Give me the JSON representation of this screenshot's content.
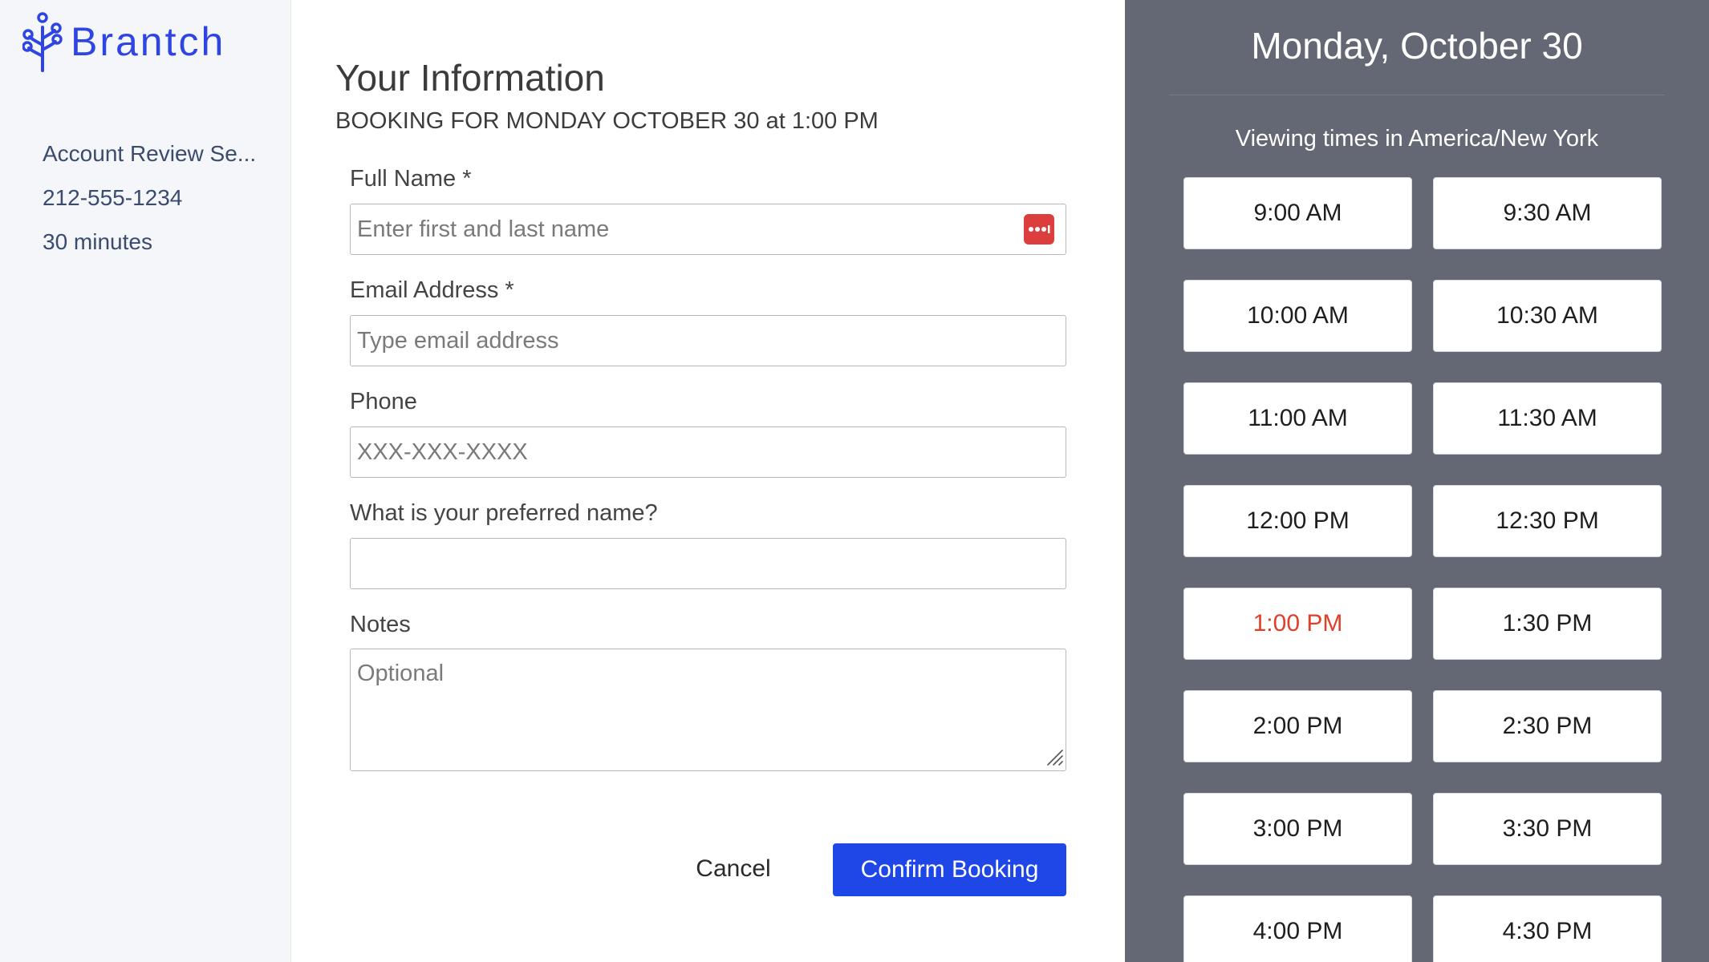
{
  "brand": {
    "name": "Brantch",
    "color": "#2f45e3",
    "icon": "branch-logo-icon"
  },
  "sidebar": {
    "items": [
      "Account Review Se...",
      "212-555-1234",
      "30 minutes"
    ]
  },
  "form": {
    "title": "Your Information",
    "subtitle": "BOOKING FOR MONDAY OCTOBER 30 at 1:00 PM",
    "fields": {
      "full_name": {
        "label": "Full Name *",
        "placeholder": "Enter first and last name",
        "value": ""
      },
      "email": {
        "label": "Email Address *",
        "placeholder": "Type email address",
        "value": ""
      },
      "phone": {
        "label": "Phone",
        "placeholder": "XXX-XXX-XXXX",
        "value": ""
      },
      "preferred_name": {
        "label": "What is your preferred name?",
        "placeholder": "",
        "value": ""
      },
      "notes": {
        "label": "Notes",
        "placeholder": "Optional",
        "value": ""
      }
    },
    "cancel_label": "Cancel",
    "confirm_label": "Confirm Booking",
    "confirm_color": "#1f47e8",
    "password_manager_icon": "password-manager-icon"
  },
  "times": {
    "date_heading": "Monday, October 30",
    "timezone_text": "Viewing times in America/New York",
    "selected": "1:00 PM",
    "selected_color": "#e0402b",
    "panel_color": "#646874",
    "slots": [
      "9:00 AM",
      "9:30 AM",
      "10:00 AM",
      "10:30 AM",
      "11:00 AM",
      "11:30 AM",
      "12:00 PM",
      "12:30 PM",
      "1:00 PM",
      "1:30 PM",
      "2:00 PM",
      "2:30 PM",
      "3:00 PM",
      "3:30 PM",
      "4:00 PM",
      "4:30 PM"
    ]
  }
}
